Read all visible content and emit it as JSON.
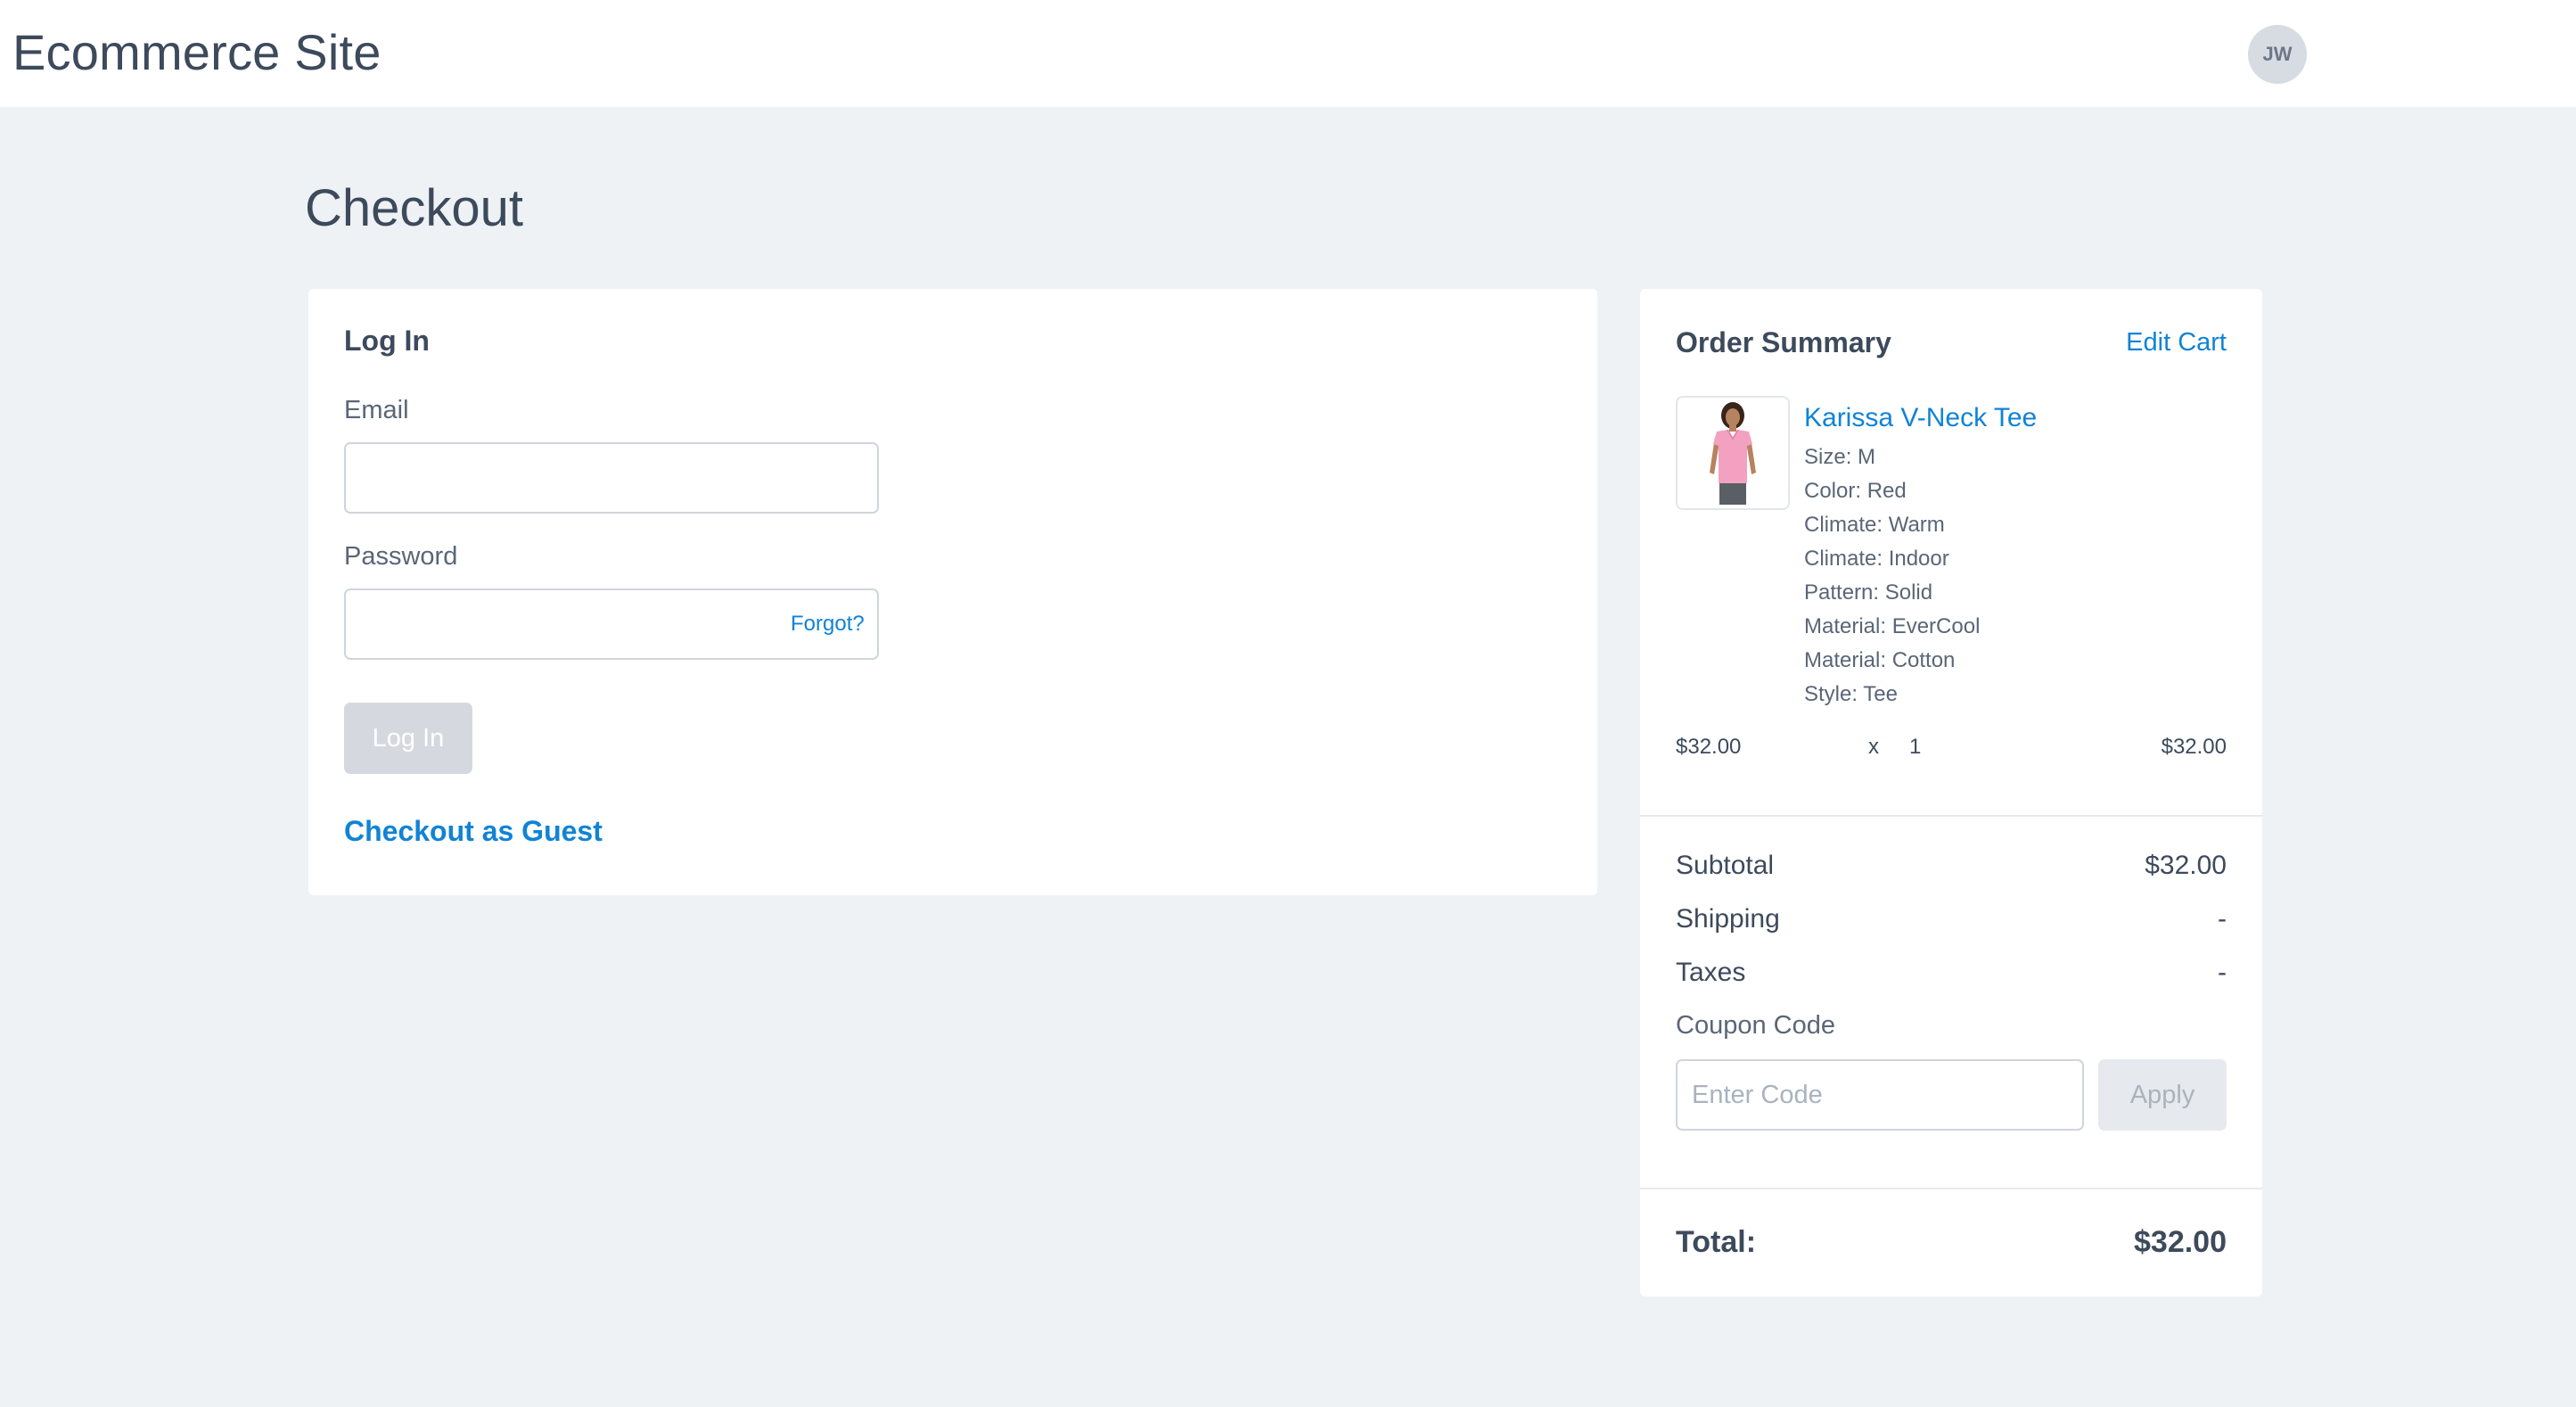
{
  "header": {
    "site_title": "Ecommerce Site",
    "avatar_initials": "JW"
  },
  "page": {
    "title": "Checkout"
  },
  "login": {
    "heading": "Log In",
    "email_label": "Email",
    "email_value": "",
    "password_label": "Password",
    "password_value": "",
    "forgot_label": "Forgot?",
    "login_button": "Log In",
    "guest_link": "Checkout as Guest"
  },
  "summary": {
    "heading": "Order Summary",
    "edit_cart": "Edit Cart",
    "items": [
      {
        "name": "Karissa V-Neck Tee",
        "thumbnail_icon": "pink-tee-product-photo",
        "attributes": [
          "Size: M",
          "Color: Red",
          "Climate: Warm",
          "Climate: Indoor",
          "Pattern: Solid",
          "Material: EverCool",
          "Material: Cotton",
          "Style: Tee"
        ],
        "unit_price": "$32.00",
        "times": "x",
        "quantity": "1",
        "line_total": "$32.00"
      }
    ],
    "subtotal_label": "Subtotal",
    "subtotal_value": "$32.00",
    "shipping_label": "Shipping",
    "shipping_value": "-",
    "taxes_label": "Taxes",
    "taxes_value": "-",
    "coupon_label": "Coupon Code",
    "coupon_placeholder": "Enter Code",
    "coupon_value": "",
    "apply_button": "Apply",
    "total_label": "Total:",
    "total_value": "$32.00"
  },
  "colors": {
    "background": "#eff2f5",
    "accent_link": "#1083d6",
    "text": "#3d4a5c",
    "disabled_button": "#d5d9df"
  }
}
